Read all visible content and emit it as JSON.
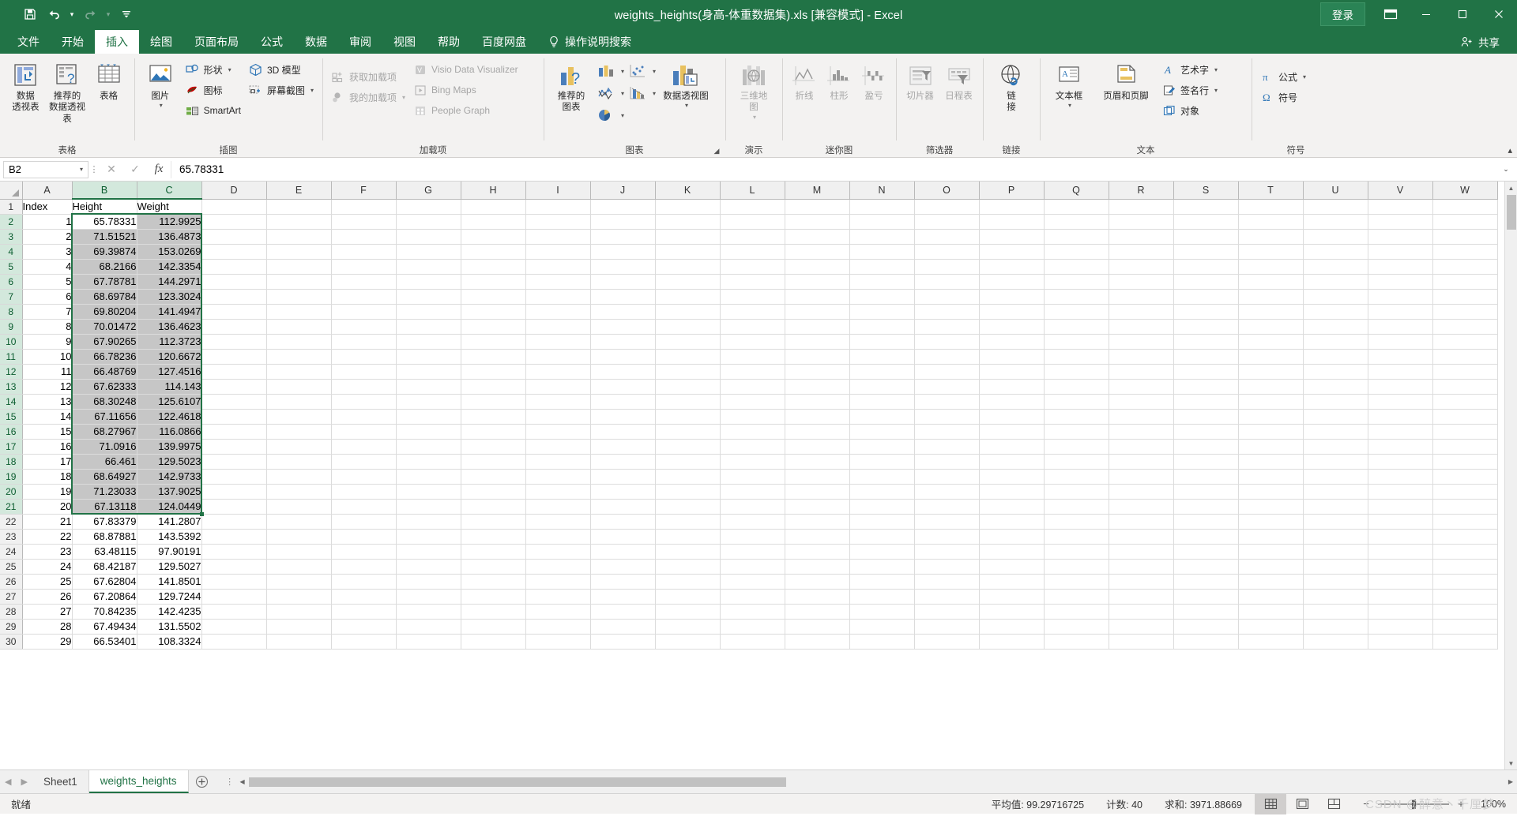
{
  "titlebar": {
    "filename": "weights_heights(身高-体重数据集).xls  [兼容模式]  -  Excel",
    "qat": [
      {
        "name": "save",
        "glyph": "💾"
      },
      {
        "name": "undo",
        "glyph": "↶"
      },
      {
        "name": "redo",
        "glyph": "↷"
      },
      {
        "name": "customize",
        "glyph": "☰"
      }
    ],
    "signin_label": "登录",
    "ribbon_display_label": "ribbon-display-options",
    "minimize": "─",
    "restore": "❐",
    "close": "✕"
  },
  "tabs": {
    "items": [
      {
        "key": "file",
        "label": "文件",
        "active": false
      },
      {
        "key": "home",
        "label": "开始",
        "active": false
      },
      {
        "key": "insert",
        "label": "插入",
        "active": true
      },
      {
        "key": "draw",
        "label": "绘图",
        "active": false
      },
      {
        "key": "layout",
        "label": "页面布局",
        "active": false
      },
      {
        "key": "formulas",
        "label": "公式",
        "active": false
      },
      {
        "key": "data",
        "label": "数据",
        "active": false
      },
      {
        "key": "review",
        "label": "审阅",
        "active": false
      },
      {
        "key": "view",
        "label": "视图",
        "active": false
      },
      {
        "key": "help",
        "label": "帮助",
        "active": false
      },
      {
        "key": "baidu",
        "label": "百度网盘",
        "active": false
      }
    ],
    "tell_me": "操作说明搜索",
    "share": "共享"
  },
  "ribbon": {
    "groups": [
      {
        "key": "tables",
        "label": "表格"
      },
      {
        "key": "illustrations",
        "label": "插图"
      },
      {
        "key": "addins",
        "label": "加载项"
      },
      {
        "key": "charts",
        "label": "图表"
      },
      {
        "key": "tours",
        "label": "演示"
      },
      {
        "key": "sparklines",
        "label": "迷你图"
      },
      {
        "key": "filters",
        "label": "筛选器"
      },
      {
        "key": "links",
        "label": "链接"
      },
      {
        "key": "text",
        "label": "文本"
      },
      {
        "key": "symbols",
        "label": "符号"
      }
    ],
    "tables": {
      "pivottable_l1": "数据",
      "pivottable_l2": "透视表",
      "recommended_l1": "推荐的",
      "recommended_l2": "数据透视表",
      "table": "表格"
    },
    "illustrations": {
      "pictures": "图片",
      "shapes": "形状",
      "icons": "图标",
      "smartart": "SmartArt",
      "model3d": "3D 模型",
      "screenshot": "屏幕截图"
    },
    "addins": {
      "get_addins": "获取加载项",
      "my_addins": "我的加载项",
      "visio": "Visio Data Visualizer",
      "bing_maps": "Bing Maps",
      "people_graph": "People Graph"
    },
    "charts": {
      "recommended_l1": "推荐的",
      "recommended_l2": "图表",
      "pivotchart_l1": "数据透视图"
    },
    "tours": {
      "map3d_l1": "三维地",
      "map3d_l2": "图"
    },
    "sparklines": {
      "line": "折线",
      "column": "柱形",
      "winloss": "盈亏"
    },
    "filters": {
      "slicer": "切片器",
      "timeline": "日程表"
    },
    "links": {
      "link_l1": "链",
      "link_l2": "接"
    },
    "text": {
      "textbox": "文本框",
      "header_footer": "页眉和页脚",
      "wordart": "艺术字",
      "signature_line": "签名行",
      "object": "对象"
    },
    "symbols": {
      "equation": "公式",
      "symbol": "符号"
    }
  },
  "formulabar": {
    "namebox_value": "B2",
    "cancel_icon": "✕",
    "enter_icon": "✓",
    "fx_icon": "fx",
    "value": "65.78331",
    "expand_icon": "⌄"
  },
  "grid": {
    "columns": [
      "A",
      "B",
      "C",
      "D",
      "E",
      "F",
      "G",
      "H",
      "I",
      "J",
      "K",
      "L",
      "M",
      "N",
      "O",
      "P",
      "Q",
      "R",
      "S",
      "T",
      "U",
      "V",
      "W"
    ],
    "selected_columns": [
      "B",
      "C"
    ],
    "headers": [
      "Index",
      "Height",
      "Weight"
    ],
    "first_row_number": 1,
    "last_row_number": 30,
    "selection_range": "B2:C21",
    "active_cell": "B2",
    "rows": [
      {
        "r": 2,
        "index": "1",
        "height": "65.78331",
        "weight": "112.9925"
      },
      {
        "r": 3,
        "index": "2",
        "height": "71.51521",
        "weight": "136.4873"
      },
      {
        "r": 4,
        "index": "3",
        "height": "69.39874",
        "weight": "153.0269"
      },
      {
        "r": 5,
        "index": "4",
        "height": "68.2166",
        "weight": "142.3354"
      },
      {
        "r": 6,
        "index": "5",
        "height": "67.78781",
        "weight": "144.2971"
      },
      {
        "r": 7,
        "index": "6",
        "height": "68.69784",
        "weight": "123.3024"
      },
      {
        "r": 8,
        "index": "7",
        "height": "69.80204",
        "weight": "141.4947"
      },
      {
        "r": 9,
        "index": "8",
        "height": "70.01472",
        "weight": "136.4623"
      },
      {
        "r": 10,
        "index": "9",
        "height": "67.90265",
        "weight": "112.3723"
      },
      {
        "r": 11,
        "index": "10",
        "height": "66.78236",
        "weight": "120.6672"
      },
      {
        "r": 12,
        "index": "11",
        "height": "66.48769",
        "weight": "127.4516"
      },
      {
        "r": 13,
        "index": "12",
        "height": "67.62333",
        "weight": "114.143"
      },
      {
        "r": 14,
        "index": "13",
        "height": "68.30248",
        "weight": "125.6107"
      },
      {
        "r": 15,
        "index": "14",
        "height": "67.11656",
        "weight": "122.4618"
      },
      {
        "r": 16,
        "index": "15",
        "height": "68.27967",
        "weight": "116.0866"
      },
      {
        "r": 17,
        "index": "16",
        "height": "71.0916",
        "weight": "139.9975"
      },
      {
        "r": 18,
        "index": "17",
        "height": "66.461",
        "weight": "129.5023"
      },
      {
        "r": 19,
        "index": "18",
        "height": "68.64927",
        "weight": "142.9733"
      },
      {
        "r": 20,
        "index": "19",
        "height": "71.23033",
        "weight": "137.9025"
      },
      {
        "r": 21,
        "index": "20",
        "height": "67.13118",
        "weight": "124.0449"
      },
      {
        "r": 22,
        "index": "21",
        "height": "67.83379",
        "weight": "141.2807"
      },
      {
        "r": 23,
        "index": "22",
        "height": "68.87881",
        "weight": "143.5392"
      },
      {
        "r": 24,
        "index": "23",
        "height": "63.48115",
        "weight": "97.90191"
      },
      {
        "r": 25,
        "index": "24",
        "height": "68.42187",
        "weight": "129.5027"
      },
      {
        "r": 26,
        "index": "25",
        "height": "67.62804",
        "weight": "141.8501"
      },
      {
        "r": 27,
        "index": "26",
        "height": "67.20864",
        "weight": "129.7244"
      },
      {
        "r": 28,
        "index": "27",
        "height": "70.84235",
        "weight": "142.4235"
      },
      {
        "r": 29,
        "index": "28",
        "height": "67.49434",
        "weight": "131.5502"
      },
      {
        "r": 30,
        "index": "29",
        "height": "66.53401",
        "weight": "108.3324"
      }
    ]
  },
  "sheetbar": {
    "tabs": [
      {
        "label": "Sheet1",
        "active": false
      },
      {
        "label": "weights_heights",
        "active": true
      }
    ],
    "add_sheet_icon": "+"
  },
  "statusbar": {
    "state": "就绪",
    "average": "平均值: 99.29716725",
    "count": "计数: 40",
    "sum": "求和: 3971.88669",
    "views": [
      "normal-view",
      "page-layout-view",
      "page-break-view"
    ],
    "zoom_minus": "−",
    "zoom_plus": "+",
    "zoom_pct": "100%",
    "watermark": "CSDN @醉意丶千厘梦"
  },
  "colors": {
    "excel_green": "#217346",
    "title_bar": "#217346",
    "ribbon_bg": "#f3f2f1",
    "selection_border": "#217346",
    "selection_fill": "#c6c6c6",
    "header_sel": "#d3e8dc"
  }
}
